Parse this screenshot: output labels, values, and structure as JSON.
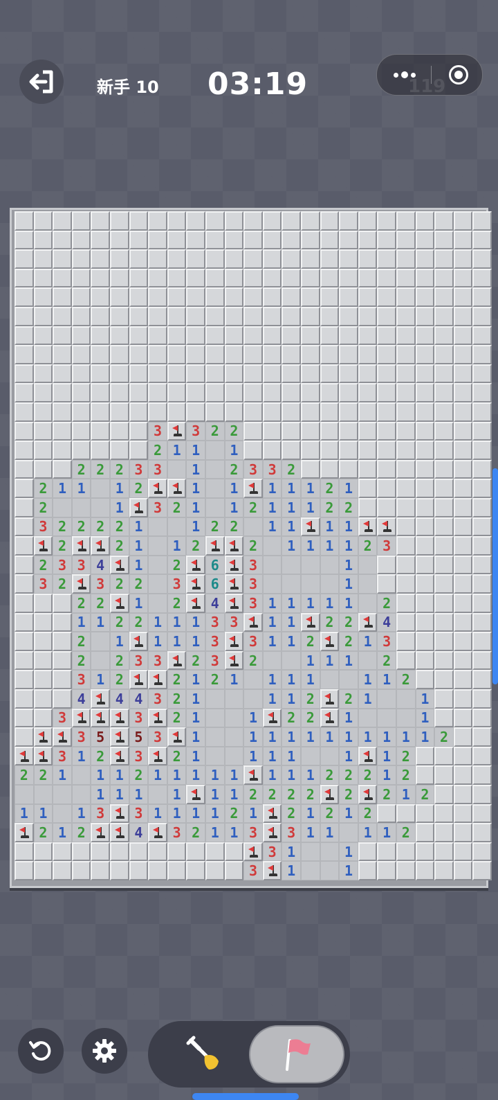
{
  "header": {
    "exit_icon": "exit-icon",
    "level_label": "新手 10",
    "timer": "03:19",
    "flags_remaining": "119",
    "menu_icon": "more-dots-icon",
    "close_icon": "target-circle-icon"
  },
  "board": {
    "cols": 25,
    "rows": 35,
    "legend": "H = hidden tile, . = revealed empty, 1-8 = revealed number, F = flagged tile",
    "rows_data": [
      "HHHHHHHHHHHHHHHHHHHHHHHHH",
      "HHHHHHHHHHHHHHHHHHHHHHHHH",
      "HHHHHHHHHHHHHHHHHHHHHHHHH",
      "HHHHHHHHHHHHHHHHHHHHHHHHH",
      "HHHHHHHHHHHHHHHHHHHHHHHHH",
      "HHHHHHHHHHHHHHHHHHHHHHHHH",
      "HHHHHHHHHHHHHHHHHHHHHHHHH",
      "HHHHHHHHHHHHHHHHHHHHHHHHH",
      "HHHHHHHHHHHHHHHHHHHHHHHHH",
      "HHHHHHHHHHHHHHHHHHHHHHHHH",
      "HHHHHHHHHHHHHHHHHHHHHHHHH",
      "HHHHHHH3F322HHHHHHHHHHHHH",
      "HHHHHHH211.1HHHHHHHHHHHHH",
      "HHH22233.1.2332HHHHHHHHHH",
      "H211.12FF1.1F11121HHHHHHH",
      "H2...1F321.1211122HHHHHHH",
      "H322221..122.11F11FFHHHHH",
      "HF2FF21.12FF2.111123HHHHH",
      "H2334F1.2F6F3....1.HHHHHH",
      "H32F322.3F6F3....1.HHHHHH",
      "HHH22F1.2F4F311111.2HHHHH",
      "HHH112211133F11F22F4HHHHH",
      "HHH2.1F1113F3112F213HHHHH",
      "HHH2.233F23F2..111.2HHHHH",
      "HHH312FF2121.111..112HHHH",
      "HHH4F44321...112F21..1HHH",
      "HH3FFF3F21..1F22F1...1HHH",
      "HFF35F53F1..11111111112HH",
      "FF312F3F21..111..1F12HHHH",
      "221.11211111F11122212HHHH",
      "....111.1F112222F2F212HHH",
      "11.13F3111121F21212HHHHHH",
      "F212FF4F32113F311.112HHHH",
      "HHHHHHHHHHHHF31..1HHHHHHH",
      "HHHHHHHHHHHH3F1..1HHHHHHH"
    ]
  },
  "controls": {
    "restart_icon": "restart-icon",
    "settings_icon": "gear-icon",
    "dig_mode_icon": "shovel-icon",
    "flag_mode_icon": "flag-icon",
    "active_mode": "flag"
  }
}
